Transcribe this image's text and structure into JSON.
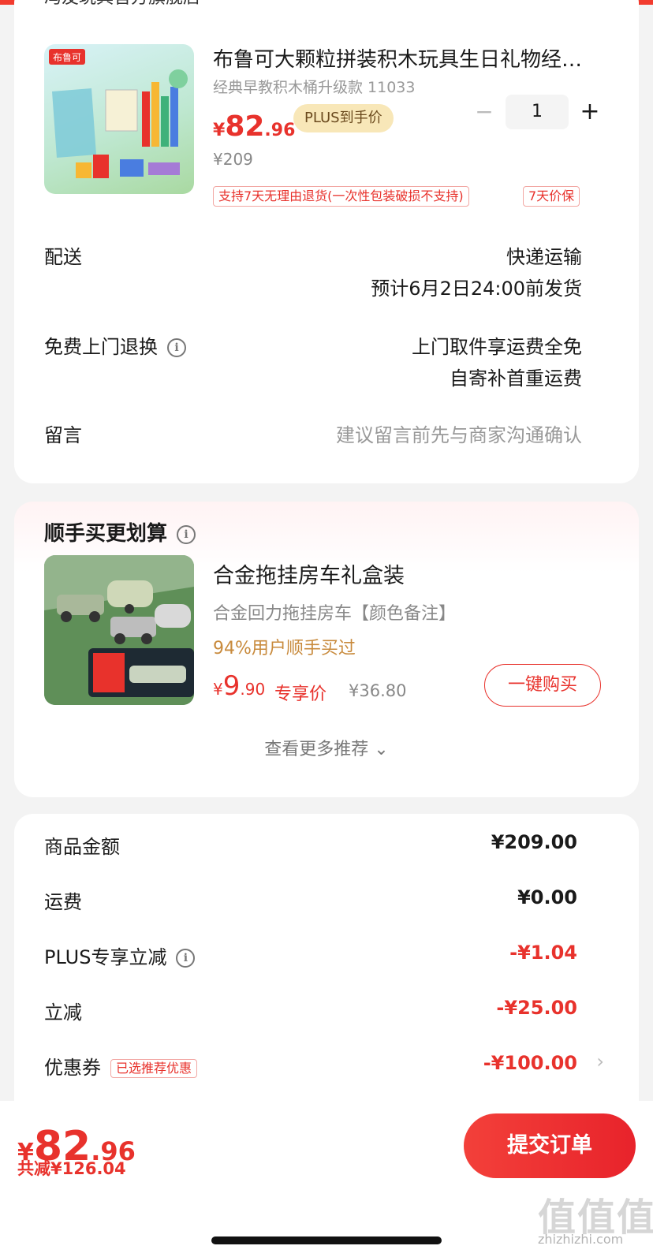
{
  "shop": {
    "name": "冯友玩具官方旗舰店"
  },
  "product": {
    "title": "布鲁可大颗粒拼装积木玩具生日礼物经…",
    "subtitle": "经典早教积木桶升级款 11033",
    "price_yen": "¥",
    "price_int": "82",
    "price_dec": ".96",
    "plus_badge": "PLUS到手价",
    "original_price": "¥209",
    "quantity": "1",
    "minus_symbol": "−",
    "plus_symbol": "+",
    "tags": [
      "支持7天无理由退货(一次性包装破损不支持)",
      "7天价保"
    ],
    "image_brand": "布鲁可"
  },
  "delivery": {
    "label": "配送",
    "method": "快递运输",
    "estimate": "预计6月2日24:00前发货"
  },
  "returns": {
    "label": "免费上门退换",
    "line1": "上门取件享运费全免",
    "line2": "自寄补首重运费"
  },
  "message": {
    "label": "留言",
    "placeholder": "建议留言前先与商家沟通确认"
  },
  "bundle": {
    "section_title": "顺手买更划算",
    "title": "合金拖挂房车礼盒装",
    "subtitle": "合金回力拖挂房车【颜色备注】",
    "rate": "94%用户顺手买过",
    "price_yen": "¥",
    "price_int": "9",
    "price_dec": ".90",
    "exclusive": "专享价",
    "original_price": "¥36.80",
    "buy_button": "一键购买",
    "more": "查看更多推荐 ⌄"
  },
  "summary": {
    "rows": [
      {
        "label": "商品金额",
        "value": "¥209.00"
      },
      {
        "label": "运费",
        "value": "¥0.00"
      },
      {
        "label": "PLUS专享立减",
        "value": "-¥1.04"
      },
      {
        "label": "立减",
        "value": "-¥25.00"
      },
      {
        "label": "优惠券",
        "value": "-¥100.00"
      }
    ],
    "coupon_tag": "已选推荐优惠",
    "chevron": "›"
  },
  "footer": {
    "total_yen": "¥",
    "total_int": "82",
    "total_dec": ".96",
    "saved": "共减¥126.04",
    "submit": "提交订单",
    "watermark": "值值值",
    "watermark_url": "zhizhizhi.com"
  },
  "icons": {
    "info": "info-icon"
  },
  "colors": {
    "accent": "#e8322c",
    "plus_badge_bg": "#f8e7b8",
    "rate": "#c88a3c"
  }
}
